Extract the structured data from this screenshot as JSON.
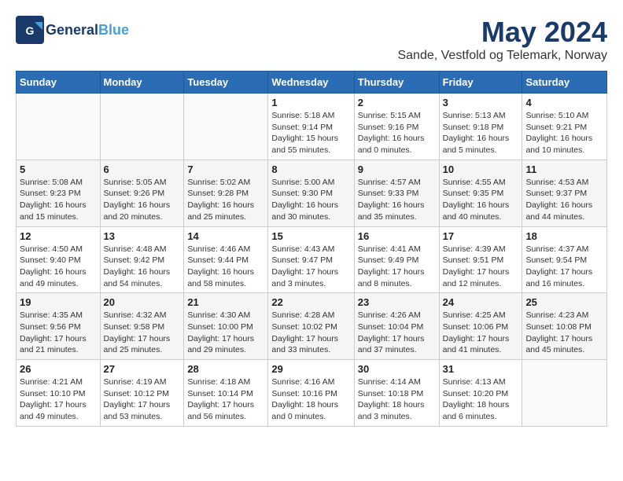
{
  "header": {
    "logo_general": "General",
    "logo_blue": "Blue",
    "month_title": "May 2024",
    "location": "Sande, Vestfold og Telemark, Norway"
  },
  "columns": [
    "Sunday",
    "Monday",
    "Tuesday",
    "Wednesday",
    "Thursday",
    "Friday",
    "Saturday"
  ],
  "weeks": [
    [
      {
        "day": "",
        "info": ""
      },
      {
        "day": "",
        "info": ""
      },
      {
        "day": "",
        "info": ""
      },
      {
        "day": "1",
        "info": "Sunrise: 5:18 AM\nSunset: 9:14 PM\nDaylight: 15 hours\nand 55 minutes."
      },
      {
        "day": "2",
        "info": "Sunrise: 5:15 AM\nSunset: 9:16 PM\nDaylight: 16 hours\nand 0 minutes."
      },
      {
        "day": "3",
        "info": "Sunrise: 5:13 AM\nSunset: 9:18 PM\nDaylight: 16 hours\nand 5 minutes."
      },
      {
        "day": "4",
        "info": "Sunrise: 5:10 AM\nSunset: 9:21 PM\nDaylight: 16 hours\nand 10 minutes."
      }
    ],
    [
      {
        "day": "5",
        "info": "Sunrise: 5:08 AM\nSunset: 9:23 PM\nDaylight: 16 hours\nand 15 minutes."
      },
      {
        "day": "6",
        "info": "Sunrise: 5:05 AM\nSunset: 9:26 PM\nDaylight: 16 hours\nand 20 minutes."
      },
      {
        "day": "7",
        "info": "Sunrise: 5:02 AM\nSunset: 9:28 PM\nDaylight: 16 hours\nand 25 minutes."
      },
      {
        "day": "8",
        "info": "Sunrise: 5:00 AM\nSunset: 9:30 PM\nDaylight: 16 hours\nand 30 minutes."
      },
      {
        "day": "9",
        "info": "Sunrise: 4:57 AM\nSunset: 9:33 PM\nDaylight: 16 hours\nand 35 minutes."
      },
      {
        "day": "10",
        "info": "Sunrise: 4:55 AM\nSunset: 9:35 PM\nDaylight: 16 hours\nand 40 minutes."
      },
      {
        "day": "11",
        "info": "Sunrise: 4:53 AM\nSunset: 9:37 PM\nDaylight: 16 hours\nand 44 minutes."
      }
    ],
    [
      {
        "day": "12",
        "info": "Sunrise: 4:50 AM\nSunset: 9:40 PM\nDaylight: 16 hours\nand 49 minutes."
      },
      {
        "day": "13",
        "info": "Sunrise: 4:48 AM\nSunset: 9:42 PM\nDaylight: 16 hours\nand 54 minutes."
      },
      {
        "day": "14",
        "info": "Sunrise: 4:46 AM\nSunset: 9:44 PM\nDaylight: 16 hours\nand 58 minutes."
      },
      {
        "day": "15",
        "info": "Sunrise: 4:43 AM\nSunset: 9:47 PM\nDaylight: 17 hours\nand 3 minutes."
      },
      {
        "day": "16",
        "info": "Sunrise: 4:41 AM\nSunset: 9:49 PM\nDaylight: 17 hours\nand 8 minutes."
      },
      {
        "day": "17",
        "info": "Sunrise: 4:39 AM\nSunset: 9:51 PM\nDaylight: 17 hours\nand 12 minutes."
      },
      {
        "day": "18",
        "info": "Sunrise: 4:37 AM\nSunset: 9:54 PM\nDaylight: 17 hours\nand 16 minutes."
      }
    ],
    [
      {
        "day": "19",
        "info": "Sunrise: 4:35 AM\nSunset: 9:56 PM\nDaylight: 17 hours\nand 21 minutes."
      },
      {
        "day": "20",
        "info": "Sunrise: 4:32 AM\nSunset: 9:58 PM\nDaylight: 17 hours\nand 25 minutes."
      },
      {
        "day": "21",
        "info": "Sunrise: 4:30 AM\nSunset: 10:00 PM\nDaylight: 17 hours\nand 29 minutes."
      },
      {
        "day": "22",
        "info": "Sunrise: 4:28 AM\nSunset: 10:02 PM\nDaylight: 17 hours\nand 33 minutes."
      },
      {
        "day": "23",
        "info": "Sunrise: 4:26 AM\nSunset: 10:04 PM\nDaylight: 17 hours\nand 37 minutes."
      },
      {
        "day": "24",
        "info": "Sunrise: 4:25 AM\nSunset: 10:06 PM\nDaylight: 17 hours\nand 41 minutes."
      },
      {
        "day": "25",
        "info": "Sunrise: 4:23 AM\nSunset: 10:08 PM\nDaylight: 17 hours\nand 45 minutes."
      }
    ],
    [
      {
        "day": "26",
        "info": "Sunrise: 4:21 AM\nSunset: 10:10 PM\nDaylight: 17 hours\nand 49 minutes."
      },
      {
        "day": "27",
        "info": "Sunrise: 4:19 AM\nSunset: 10:12 PM\nDaylight: 17 hours\nand 53 minutes."
      },
      {
        "day": "28",
        "info": "Sunrise: 4:18 AM\nSunset: 10:14 PM\nDaylight: 17 hours\nand 56 minutes."
      },
      {
        "day": "29",
        "info": "Sunrise: 4:16 AM\nSunset: 10:16 PM\nDaylight: 18 hours\nand 0 minutes."
      },
      {
        "day": "30",
        "info": "Sunrise: 4:14 AM\nSunset: 10:18 PM\nDaylight: 18 hours\nand 3 minutes."
      },
      {
        "day": "31",
        "info": "Sunrise: 4:13 AM\nSunset: 10:20 PM\nDaylight: 18 hours\nand 6 minutes."
      },
      {
        "day": "",
        "info": ""
      }
    ]
  ]
}
